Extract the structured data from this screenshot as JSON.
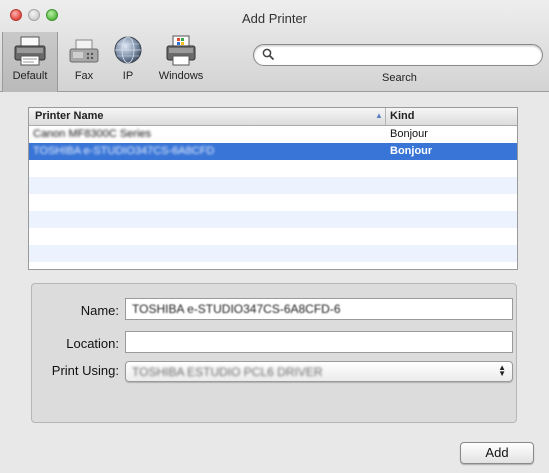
{
  "window": {
    "title": "Add Printer"
  },
  "toolbar": {
    "items": [
      {
        "label": "Default",
        "icon": "printer-icon",
        "selected": true
      },
      {
        "label": "Fax",
        "icon": "fax-icon"
      },
      {
        "label": "IP",
        "icon": "globe-icon"
      },
      {
        "label": "Windows",
        "icon": "windows-printer-icon"
      }
    ],
    "search": {
      "label": "Search",
      "value": ""
    }
  },
  "printer_list": {
    "columns": [
      {
        "label": "Printer Name",
        "sort": "ascending"
      },
      {
        "label": "Kind"
      }
    ],
    "rows": [
      {
        "name": "Canon MF8300C Series",
        "kind": "Bonjour",
        "selected": false
      },
      {
        "name": "TOSHIBA e-STUDIO347CS-6A8CFD",
        "kind": "Bonjour",
        "selected": true
      }
    ]
  },
  "details": {
    "name_label": "Name:",
    "name_value": "TOSHIBA e-STUDIO347CS-6A8CFD-6",
    "location_label": "Location:",
    "location_value": "",
    "print_using_label": "Print Using:",
    "print_using_value": "TOSHIBA ESTUDIO PCL6 DRIVER"
  },
  "buttons": {
    "add": "Add"
  },
  "colors": {
    "selection": "#3875d7",
    "stripe": "#edf3fe"
  }
}
